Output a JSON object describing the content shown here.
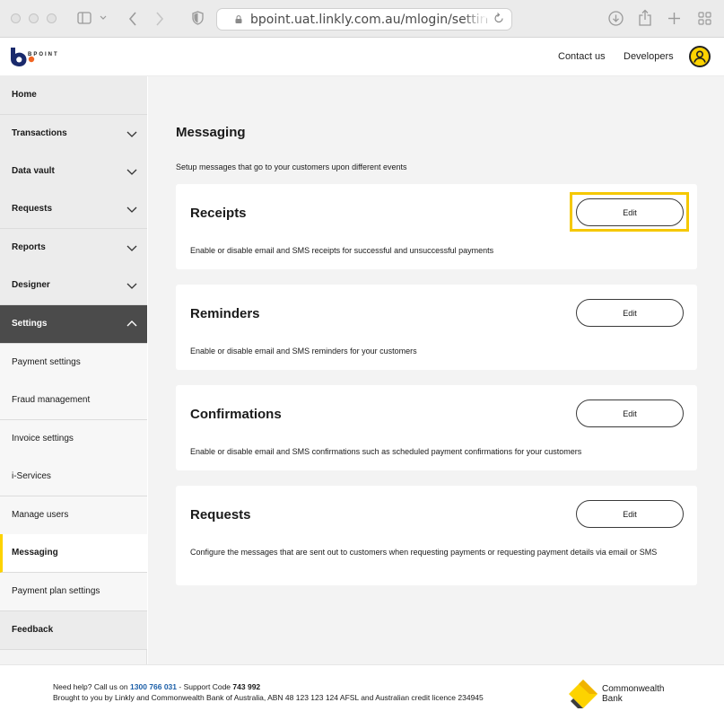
{
  "browser": {
    "url": "bpoint.uat.linkly.com.au/mlogin/settings/messag"
  },
  "header": {
    "logo_text": "BPOINT",
    "contact": "Contact us",
    "developers": "Developers"
  },
  "sidebar": {
    "items": [
      {
        "label": "Home"
      },
      {
        "label": "Transactions"
      },
      {
        "label": "Data vault"
      },
      {
        "label": "Requests"
      },
      {
        "label": "Reports"
      },
      {
        "label": "Designer"
      },
      {
        "label": "Settings"
      },
      {
        "label": "Payment settings"
      },
      {
        "label": "Fraud management"
      },
      {
        "label": "Invoice settings"
      },
      {
        "label": "i-Services"
      },
      {
        "label": "Manage users"
      },
      {
        "label": "Messaging"
      },
      {
        "label": "Payment plan settings"
      },
      {
        "label": "Feedback"
      }
    ],
    "active": "Messaging"
  },
  "main": {
    "title": "Messaging",
    "description": "Setup messages that go to your customers upon different events",
    "cards": [
      {
        "title": "Receipts",
        "desc": "Enable or disable email and SMS receipts for successful and unsuccessful payments",
        "button": "Edit"
      },
      {
        "title": "Reminders",
        "desc": "Enable or disable email and SMS reminders for your customers",
        "button": "Edit"
      },
      {
        "title": "Confirmations",
        "desc": "Enable or disable email and SMS confirmations such as scheduled payment confirmations for your customers",
        "button": "Edit"
      },
      {
        "title": "Requests",
        "desc": "Configure the messages that are sent out to customers when requesting payments or requesting payment details via email or SMS",
        "button": "Edit"
      }
    ]
  },
  "footer": {
    "help_prefix": "Need help? Call us on",
    "phone": "1300 766 031",
    "support_prefix": "- Support Code",
    "support_code": "743 992",
    "credit": "Brought to you by Linkly and Commonwealth Bank of Australia, ABN 48 123 123 124 AFSL and Australian credit licence 234945",
    "bank_line1": "Commonwealth",
    "bank_line2": "Bank"
  },
  "colors": {
    "brand_yellow": "#fdd300",
    "highlight": "#f5c800",
    "nav_selected_bg": "#4b4b4b",
    "phone_link": "#1c5fa8"
  }
}
